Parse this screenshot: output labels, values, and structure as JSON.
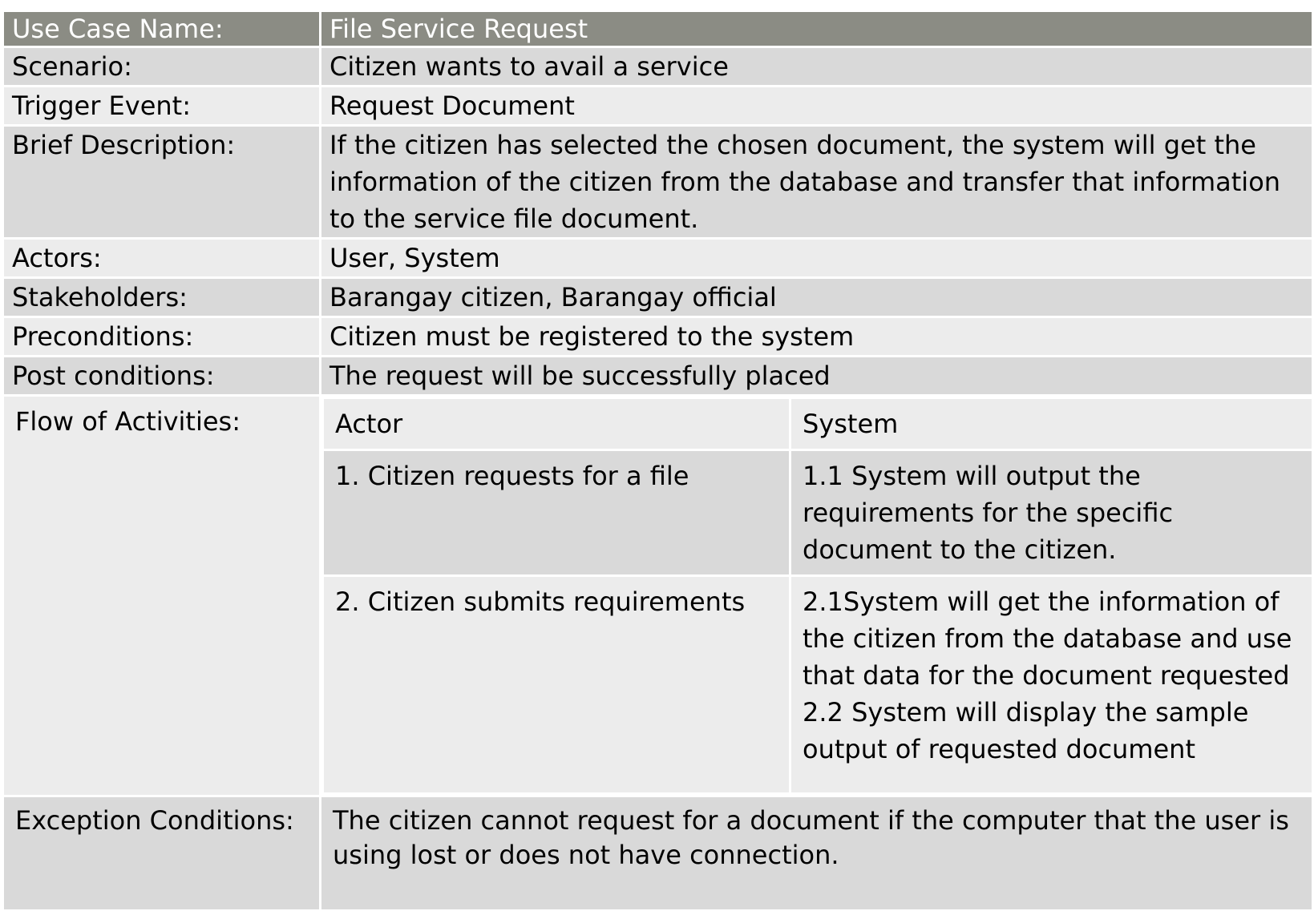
{
  "use_case": {
    "header": {
      "label": "Use Case Name:",
      "value": "File Service Request"
    },
    "rows": [
      {
        "label": "Scenario:",
        "value": "Citizen wants to avail a service"
      },
      {
        "label": "Trigger Event:",
        "value": "Request Document"
      },
      {
        "label": "Brief Description:",
        "value": "If the citizen has selected the chosen document, the system will get the information of the citizen from the database and transfer that information to the service file document."
      },
      {
        "label": "Actors:",
        "value": "User, System"
      },
      {
        "label": "Stakeholders:",
        "value": "Barangay citizen, Barangay official"
      },
      {
        "label": "Preconditions:",
        "value": "Citizen must be registered to the system"
      },
      {
        "label": "Post conditions:",
        "value": "The request will be successfully placed"
      }
    ],
    "flow": {
      "label": "Flow of Activities:",
      "actor_header": "Actor",
      "system_header": "System",
      "steps": [
        {
          "actor": "1. Citizen requests for a file",
          "system": [
            "1.1 System will output the requirements for the specific document to the citizen."
          ]
        },
        {
          "actor": "2. Citizen submits requirements",
          "system": [
            "2.1System will get the information of the citizen from the database and use that data for the document requested",
            "2.2 System will display the sample output of requested document"
          ]
        }
      ]
    },
    "exception": {
      "label": "Exception Conditions:",
      "value": "The citizen cannot request for a document if the computer that the user is using lost or does not have connection."
    }
  },
  "colors": {
    "header_bg": "#8b8c84",
    "header_text": "#ffffff",
    "row_dark": "#d9d9d9",
    "row_light": "#ececec",
    "border": "#ffffff"
  }
}
